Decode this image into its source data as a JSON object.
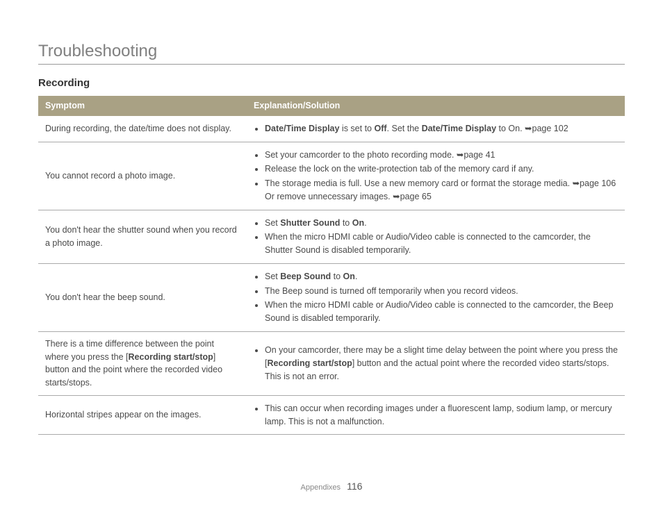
{
  "title": "Troubleshooting",
  "section": "Recording",
  "headers": {
    "symptom": "Symptom",
    "solution": "Explanation/Solution"
  },
  "rows": [
    {
      "symptom": "During recording, the date/time does not display.",
      "items": [
        [
          {
            "t": "bold",
            "v": "Date/Time Display"
          },
          {
            "t": "text",
            "v": " is set to "
          },
          {
            "t": "bold",
            "v": "Off"
          },
          {
            "t": "text",
            "v": ". Set the "
          },
          {
            "t": "bold",
            "v": "Date/Time Display"
          },
          {
            "t": "text",
            "v": " to On. "
          },
          {
            "t": "arrow"
          },
          {
            "t": "text",
            "v": "page 102"
          }
        ]
      ]
    },
    {
      "symptom": "You cannot record a photo image.",
      "items": [
        [
          {
            "t": "text",
            "v": "Set your camcorder to the photo recording mode. "
          },
          {
            "t": "arrow"
          },
          {
            "t": "text",
            "v": "page 41"
          }
        ],
        [
          {
            "t": "text",
            "v": "Release the lock on the write-protection tab of the memory card if any."
          }
        ],
        [
          {
            "t": "text",
            "v": "The storage media is full. Use a new memory card or format the storage media. "
          },
          {
            "t": "arrow"
          },
          {
            "t": "text",
            "v": "page 106 Or remove unnecessary images. "
          },
          {
            "t": "arrow"
          },
          {
            "t": "text",
            "v": "page 65"
          }
        ]
      ]
    },
    {
      "symptom": "You don't hear the shutter sound when you record a photo image.",
      "items": [
        [
          {
            "t": "text",
            "v": "Set "
          },
          {
            "t": "bold",
            "v": "Shutter Sound"
          },
          {
            "t": "text",
            "v": " to "
          },
          {
            "t": "bold",
            "v": "On"
          },
          {
            "t": "text",
            "v": "."
          }
        ],
        [
          {
            "t": "text",
            "v": "When the micro HDMI cable or Audio/Video cable is connected to the camcorder, the Shutter Sound is disabled temporarily."
          }
        ]
      ]
    },
    {
      "symptom": "You don't hear the beep sound.",
      "items": [
        [
          {
            "t": "text",
            "v": "Set "
          },
          {
            "t": "bold",
            "v": "Beep Sound"
          },
          {
            "t": "text",
            "v": " to "
          },
          {
            "t": "bold",
            "v": "On"
          },
          {
            "t": "text",
            "v": "."
          }
        ],
        [
          {
            "t": "text",
            "v": "The Beep sound is turned off temporarily when you record videos."
          }
        ],
        [
          {
            "t": "text",
            "v": "When the micro HDMI cable or Audio/Video cable is connected to the camcorder, the Beep Sound is disabled temporarily."
          }
        ]
      ]
    },
    {
      "symptom_rich": [
        {
          "t": "text",
          "v": "There is a time difference between the point where you press the ["
        },
        {
          "t": "bold",
          "v": "Recording start/stop"
        },
        {
          "t": "text",
          "v": "] button and the point where the recorded video starts/stops."
        }
      ],
      "items": [
        [
          {
            "t": "text",
            "v": "On your camcorder, there may be a slight time delay between the point where you press the ["
          },
          {
            "t": "bold",
            "v": "Recording start/stop"
          },
          {
            "t": "text",
            "v": "] button and the actual point where the recorded video starts/stops. This is not an error."
          }
        ]
      ]
    },
    {
      "symptom": "Horizontal stripes appear on the images.",
      "items": [
        [
          {
            "t": "text",
            "v": "This can occur when recording images under a fluorescent lamp, sodium lamp, or mercury lamp. This is not a malfunction."
          }
        ]
      ]
    }
  ],
  "footer": {
    "label": "Appendixes",
    "page": "116"
  },
  "glyphs": {
    "arrow": "➥"
  }
}
